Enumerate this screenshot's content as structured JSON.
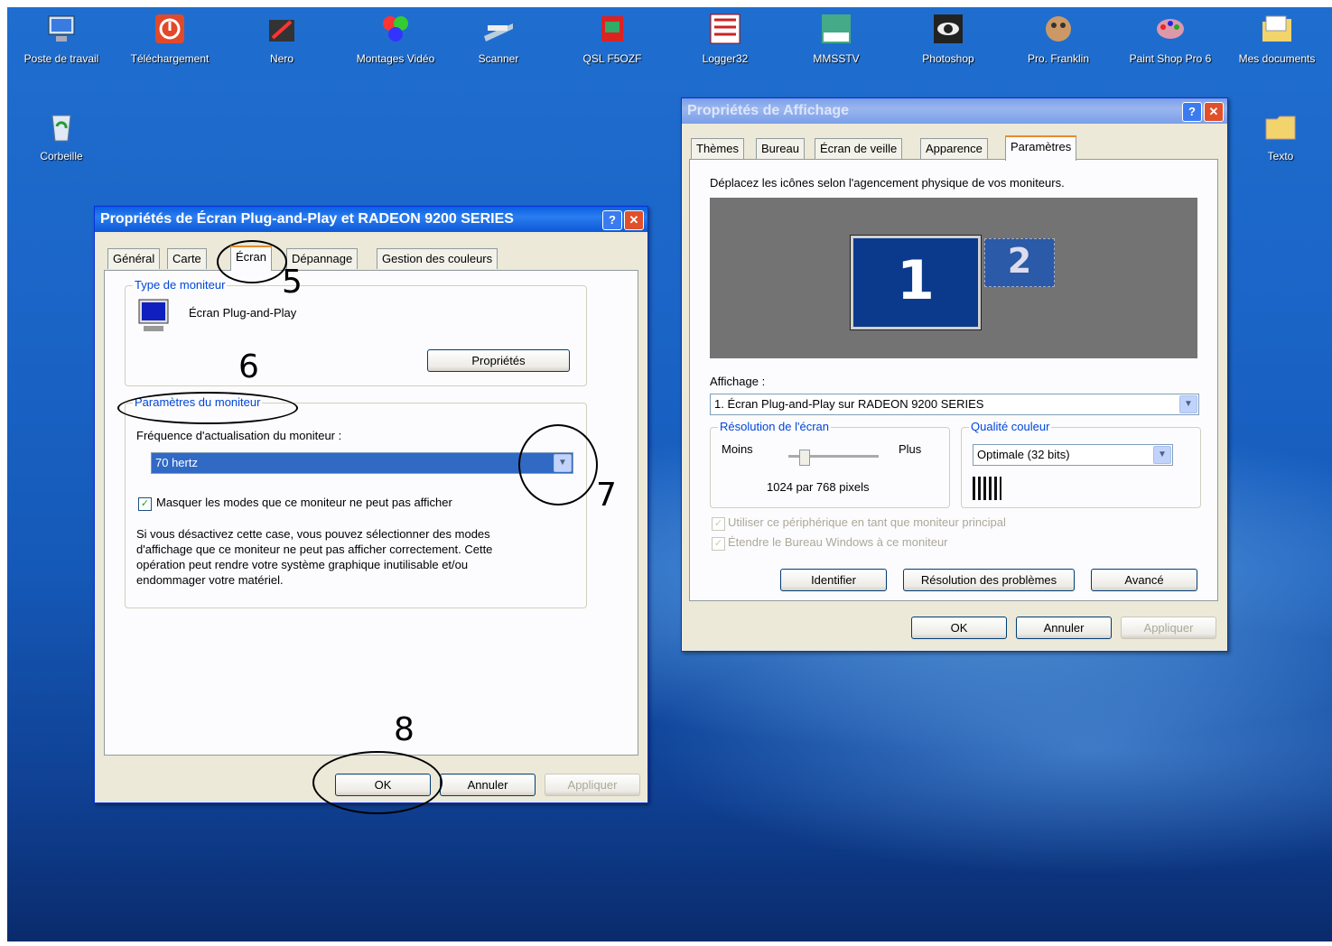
{
  "desktop": {
    "icons": [
      {
        "label": "Poste de travail",
        "icon": "computer-icon"
      },
      {
        "label": "Téléchargement",
        "icon": "download-folder-icon"
      },
      {
        "label": "Nero",
        "icon": "nero-icon"
      },
      {
        "label": "Montages Vidéo",
        "icon": "video-icon"
      },
      {
        "label": "Scanner",
        "icon": "scanner-icon"
      },
      {
        "label": "QSL F5OZF",
        "icon": "qsl-icon"
      },
      {
        "label": "Logger32",
        "icon": "logger-icon"
      },
      {
        "label": "MMSSTV",
        "icon": "sstv-icon"
      },
      {
        "label": "Photoshop",
        "icon": "photoshop-icon"
      },
      {
        "label": "Pro. Franklin",
        "icon": "franklin-icon"
      },
      {
        "label": "Paint Shop Pro 6",
        "icon": "paintshop-icon"
      },
      {
        "label": "Mes documents",
        "icon": "documents-icon"
      },
      {
        "label": "Corbeille",
        "icon": "recycle-bin-icon"
      },
      {
        "label": "Texto",
        "icon": "folder-icon"
      }
    ]
  },
  "left_window": {
    "title": "Propriétés de Écran Plug-and-Play et RADEON 9200 SERIES",
    "help_btn": "?",
    "close_btn": "✕",
    "tabs": [
      "Général",
      "Carte",
      "Écran",
      "Dépannage",
      "Gestion des couleurs"
    ],
    "monitor_type_group": "Type de moniteur",
    "monitor_name": "Écran Plug-and-Play",
    "properties_button": "Propriétés",
    "monitor_settings_group": "Paramètres du moniteur",
    "refresh_label": "Fréquence d'actualisation du moniteur :",
    "refresh_value": "70 hertz",
    "hide_modes_checked": "✓",
    "hide_modes_label": "Masquer les modes que ce moniteur ne peut pas afficher",
    "warning_text": [
      "Si vous désactivez cette case, vous pouvez sélectionner des modes",
      "d'affichage que ce moniteur ne peut pas afficher correctement. Cette",
      "opération peut rendre votre système graphique inutilisable et/ou",
      "endommager votre matériel."
    ],
    "ok_button": "OK",
    "cancel_button": "Annuler",
    "apply_button": "Appliquer"
  },
  "right_window": {
    "title": "Propriétés de Affichage",
    "help_btn": "?",
    "close_btn": "✕",
    "tabs": [
      "Thèmes",
      "Bureau",
      "Écran de veille",
      "Apparence",
      "Paramètres"
    ],
    "instruction": "Déplacez les icônes selon l'agencement physique de vos moniteurs.",
    "monitor1": "1",
    "monitor2": "2",
    "display_label": "Affichage :",
    "display_value": "1. Écran Plug-and-Play sur RADEON 9200 SERIES",
    "resolution_group": "Résolution de l'écran",
    "less_label": "Moins",
    "more_label": "Plus",
    "resolution_value": "1024 par 768 pixels",
    "color_group": "Qualité couleur",
    "color_value": "Optimale (32 bits)",
    "primary_label": "Utiliser ce périphérique en tant que moniteur principal",
    "extend_label": "Étendre le Bureau Windows à ce moniteur",
    "check_mark": "✓",
    "identify_button": "Identifier",
    "troubleshoot_button": "Résolution des problèmes",
    "advanced_button": "Avancé",
    "ok_button": "OK",
    "cancel_button": "Annuler",
    "apply_button": "Appliquer"
  },
  "annotations": {
    "n5": "5",
    "n6": "6",
    "n7": "7",
    "n8": "8"
  },
  "colors": {
    "desktop_blue": "#1a64c6",
    "title_active": "#0a5fe0",
    "tab_highlight": "#e68b2c",
    "selection": "#316ac5",
    "monitor_tile": "#0b3a8c"
  }
}
